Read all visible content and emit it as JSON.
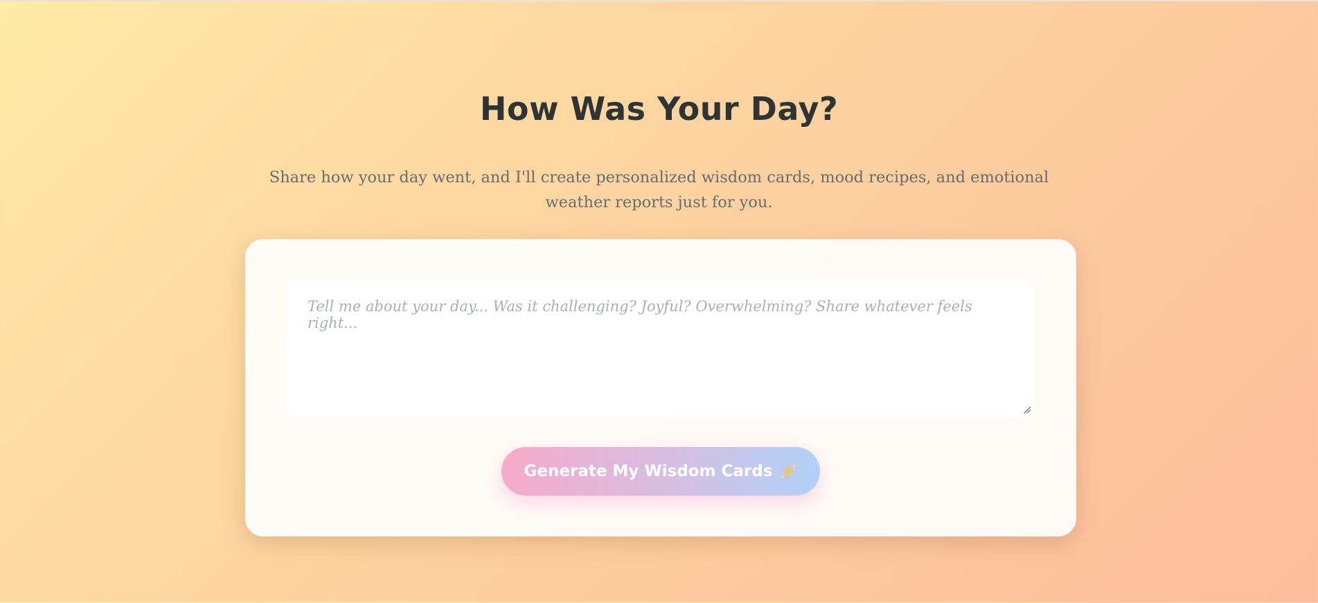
{
  "header": {
    "title": "How Was Your Day?",
    "subtitle": "Share how your day went, and I'll create personalized wisdom cards, mood recipes, and emotional weather reports just for you."
  },
  "form": {
    "day_input": {
      "placeholder": "Tell me about your day... Was it challenging? Joyful? Overwhelming? Share whatever feels right...",
      "value": ""
    },
    "generate_button": {
      "label": "Generate My Wisdom Cards",
      "icon": "sparkles-icon"
    }
  },
  "colors": {
    "background_start": "#ffeaa7",
    "background_end": "#fdbc9b",
    "title": "#2d3436",
    "subtitle": "#636e72",
    "button_gradient_start": "#f7aac9",
    "button_gradient_end": "#b0d1f9"
  }
}
